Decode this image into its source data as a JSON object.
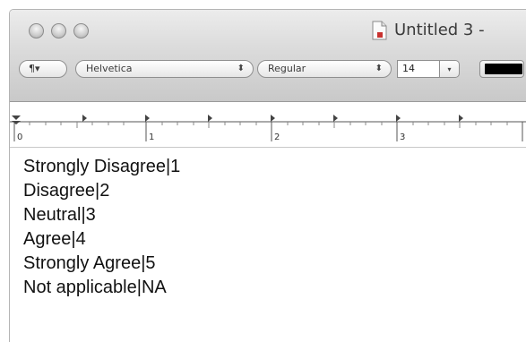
{
  "window": {
    "title": "Untitled 3 -"
  },
  "toolbar": {
    "paragraph_button_label": "¶▾",
    "font_family": "Helvetica",
    "font_style": "Regular",
    "font_size": "14",
    "size_dropdown_glyph": "▾",
    "select_arrows_glyph": "⬍",
    "text_color": "#000000"
  },
  "ruler": {
    "labels": [
      "0",
      "1",
      "2",
      "3"
    ]
  },
  "document": {
    "lines": [
      "Strongly Disagree|1",
      "Disagree|2",
      "Neutral|3",
      "Agree|4",
      "Strongly Agree|5",
      "Not applicable|NA"
    ]
  },
  "icons": {
    "close": "traffic-light-close-icon",
    "minimize": "traffic-light-minimize-icon",
    "zoom": "traffic-light-zoom-icon",
    "document": "document-icon"
  }
}
